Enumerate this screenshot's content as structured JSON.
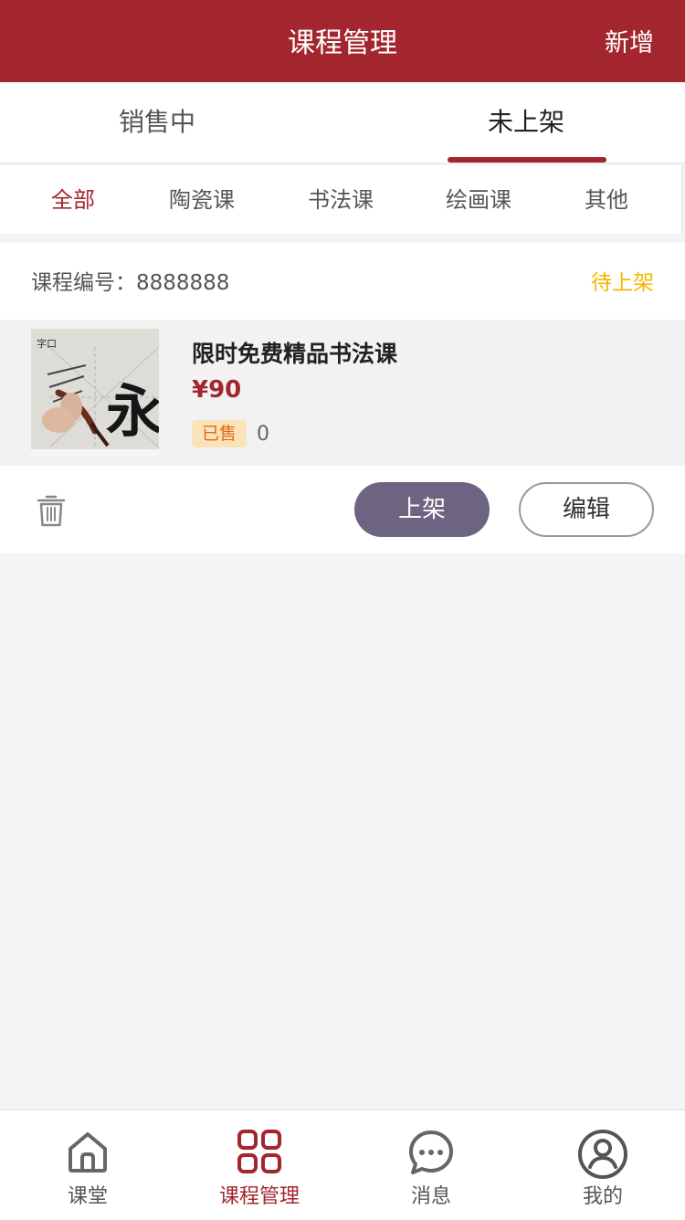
{
  "header": {
    "title": "课程管理",
    "add_label": "新增"
  },
  "tabs": [
    {
      "label": "销售中"
    },
    {
      "label": "未上架"
    }
  ],
  "categories": [
    {
      "label": "全部"
    },
    {
      "label": "陶瓷课"
    },
    {
      "label": "书法课"
    },
    {
      "label": "绘画课"
    },
    {
      "label": "其他"
    }
  ],
  "course": {
    "code_text": "课程编号：8888888",
    "status": "待上架",
    "name": "限时免费精品书法课",
    "price": "¥90",
    "sold_label": "已售",
    "sold_count": "0",
    "thumb_char": "永",
    "thumb_corner_text": "字口",
    "publish_label": "上架",
    "edit_label": "编辑"
  },
  "tabbar": [
    {
      "label": "课堂",
      "icon": "home-icon"
    },
    {
      "label": "课程管理",
      "icon": "grid-icon"
    },
    {
      "label": "消息",
      "icon": "chat-bubble-icon"
    },
    {
      "label": "我的",
      "icon": "user-circle-icon"
    }
  ],
  "colors": {
    "brand": "#a3262f",
    "status_pending": "#f0b800",
    "publish_button": "#6c6480"
  }
}
